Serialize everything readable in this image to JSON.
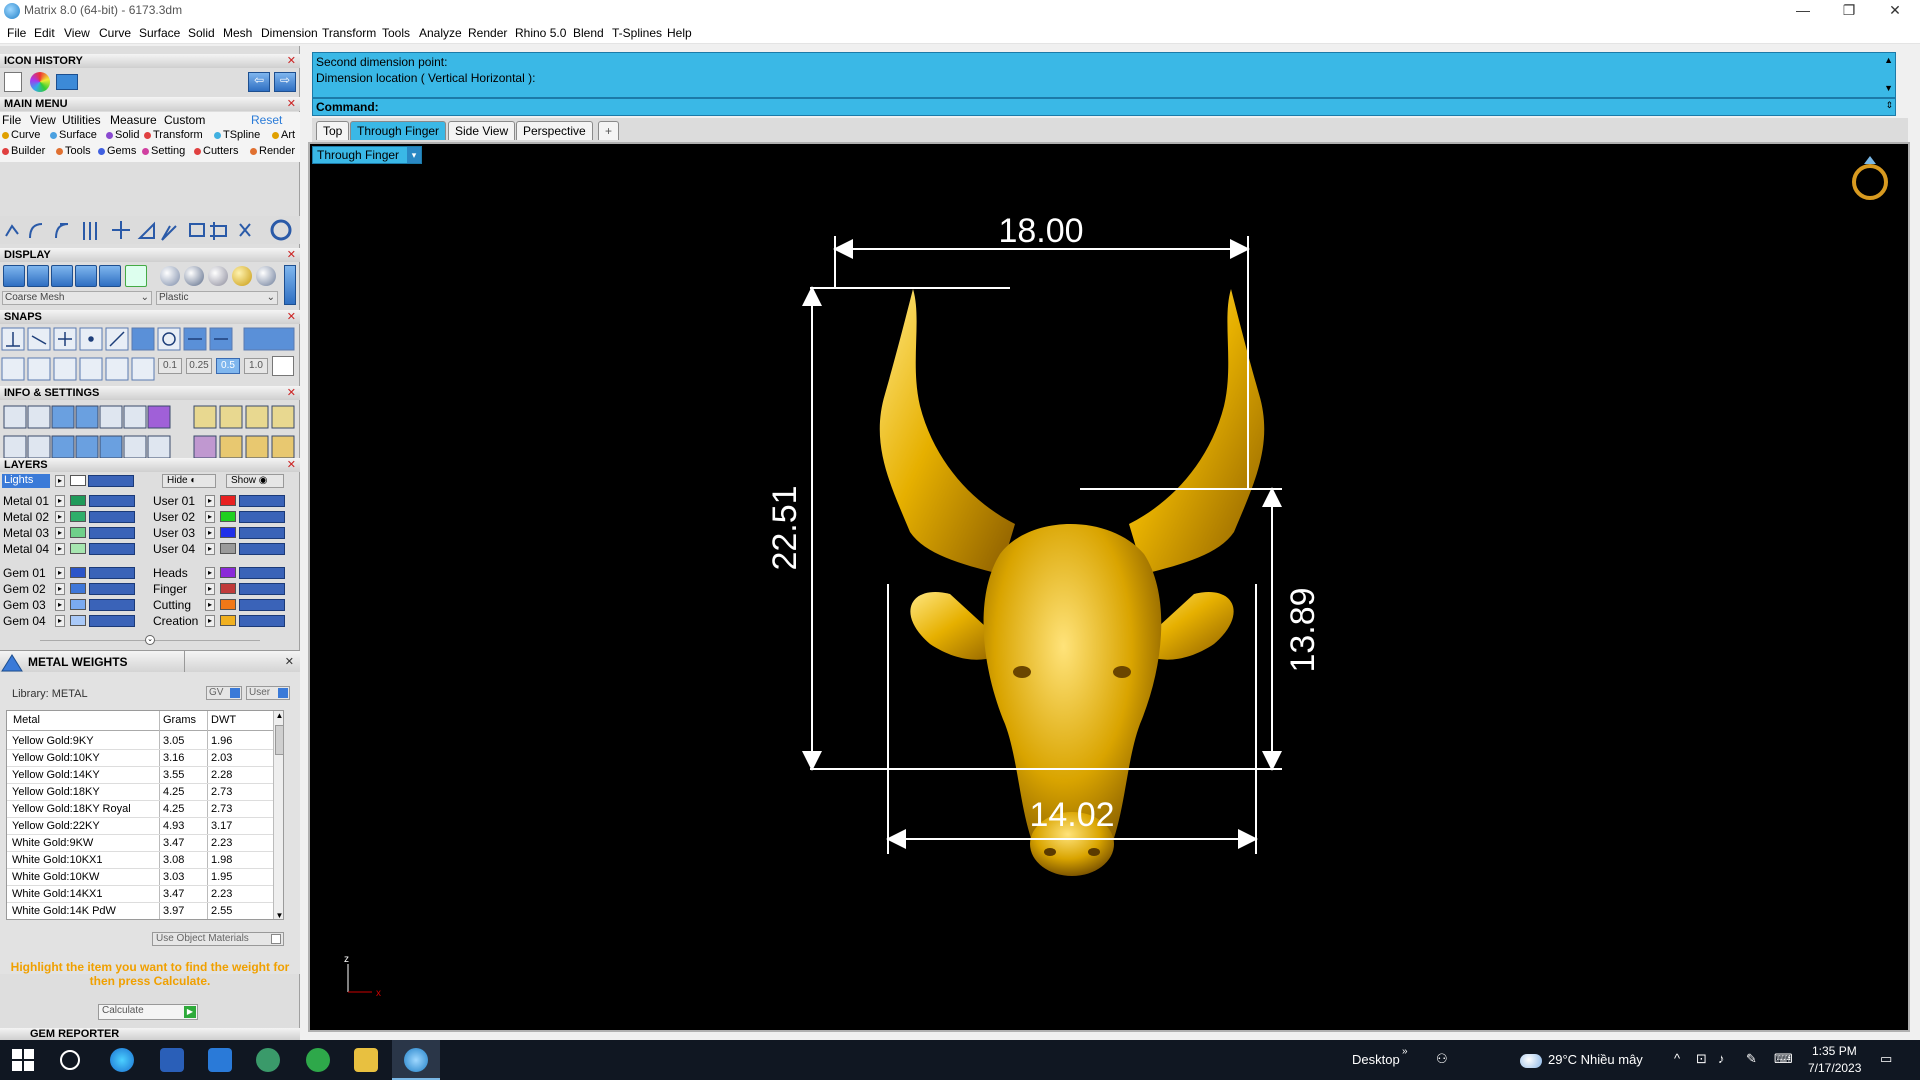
{
  "window": {
    "title": "Matrix 8.0 (64-bit) - 6173.3dm",
    "controls": [
      "—",
      "❐",
      "✕"
    ]
  },
  "menubar": {
    "items": [
      "File",
      "Edit",
      "View",
      "Curve",
      "Surface",
      "Solid",
      "Mesh",
      "Dimension",
      "Transform",
      "Tools",
      "Analyze",
      "Render",
      "Rhino 5.0",
      "Blend",
      "T-Splines",
      "Help"
    ]
  },
  "left_panel": {
    "icon_history": {
      "title": "ICON HISTORY"
    },
    "main_menu": {
      "title": "MAIN MENU",
      "top_items": [
        "File",
        "View",
        "Utilities",
        "Measure",
        "Custom"
      ],
      "reset": "Reset",
      "row1": [
        {
          "label": "Curve",
          "color": "#e0a000"
        },
        {
          "label": "Surface",
          "color": "#4aa0e0"
        },
        {
          "label": "Solid",
          "color": "#8a4ad0"
        },
        {
          "label": "Transform",
          "color": "#e04040"
        },
        {
          "label": "TSpline",
          "color": "#40b0e0"
        },
        {
          "label": "Art",
          "color": "#e0a000"
        }
      ],
      "row2": [
        {
          "label": "Builder",
          "color": "#e04040"
        },
        {
          "label": "Tools",
          "color": "#e07030"
        },
        {
          "label": "Gems",
          "color": "#4060e0"
        },
        {
          "label": "Setting",
          "color": "#d040a0"
        },
        {
          "label": "Cutters",
          "color": "#e04040"
        },
        {
          "label": "Render",
          "color": "#e07030"
        }
      ]
    },
    "display": {
      "title": "DISPLAY",
      "mesh_select": "Coarse Mesh",
      "material_select": "Plastic"
    },
    "snaps": {
      "title": "SNAPS",
      "values": [
        "0.1",
        "0.25",
        "0.5",
        "1.0"
      ]
    },
    "info_settings": {
      "title": "INFO & SETTINGS"
    },
    "layers": {
      "title": "LAYERS",
      "lights": "Lights",
      "hide": "Hide",
      "show": "Show",
      "left": [
        {
          "name": "Metal 01",
          "color": "#1f9a5a"
        },
        {
          "name": "Metal 02",
          "color": "#2fae6a"
        },
        {
          "name": "Metal 03",
          "color": "#6fd08a"
        },
        {
          "name": "Metal 04",
          "color": "#a6e6b0"
        },
        {
          "name": "Gem 01",
          "color": "#2b55c8"
        },
        {
          "name": "Gem 02",
          "color": "#3e77d8"
        },
        {
          "name": "Gem 03",
          "color": "#7aaaf0"
        },
        {
          "name": "Gem 04",
          "color": "#a9c9f8"
        }
      ],
      "right": [
        {
          "name": "User 01",
          "color": "#e82020"
        },
        {
          "name": "User 02",
          "color": "#20d020"
        },
        {
          "name": "User 03",
          "color": "#2030e8"
        },
        {
          "name": "User 04",
          "color": "#9a9a9a"
        },
        {
          "name": "Heads",
          "color": "#8a2ad8"
        },
        {
          "name": "Finger",
          "color": "#c03a3a"
        },
        {
          "name": "Cutting",
          "color": "#f07818"
        },
        {
          "name": "Creation",
          "color": "#f0b020"
        }
      ]
    },
    "metal_weights": {
      "title": "METAL WEIGHTS",
      "library": "Library: METAL",
      "gv": "GV",
      "user": "User",
      "columns": [
        "Metal",
        "Grams",
        "DWT"
      ],
      "rows": [
        [
          "Yellow Gold:9KY",
          "3.05",
          "1.96"
        ],
        [
          "Yellow Gold:10KY",
          "3.16",
          "2.03"
        ],
        [
          "Yellow Gold:14KY",
          "3.55",
          "2.28"
        ],
        [
          "Yellow Gold:18KY",
          "4.25",
          "2.73"
        ],
        [
          "Yellow Gold:18KY Royal",
          "4.25",
          "2.73"
        ],
        [
          "Yellow Gold:22KY",
          "4.93",
          "3.17"
        ],
        [
          "White Gold:9KW",
          "3.47",
          "2.23"
        ],
        [
          "White Gold:10KX1",
          "3.08",
          "1.98"
        ],
        [
          "White Gold:10KW",
          "3.03",
          "1.95"
        ],
        [
          "White Gold:14KX1",
          "3.47",
          "2.23"
        ],
        [
          "White Gold:14K PdW",
          "3.97",
          "2.55"
        ]
      ],
      "use_object_materials": "Use Object Materials",
      "hint": "Highlight the item you want to find the weight for then press Calculate.",
      "calculate": "Calculate"
    },
    "gem_reporter": {
      "title": "GEM REPORTER"
    }
  },
  "command": {
    "lines": [
      "Second dimension point:",
      "Dimension location ( Vertical  Horizontal ):"
    ],
    "label": "Command:",
    "value": ""
  },
  "viewport": {
    "tabs": [
      "Top",
      "Through Finger",
      "Side View",
      "Perspective"
    ],
    "active_tab": "Through Finger",
    "add_tab": "+",
    "view_label": "Through Finger",
    "dimensions": {
      "top_width": "18.00",
      "left_height": "22.51",
      "right_height": "13.89",
      "bottom_width": "14.02"
    },
    "axis_z": "z",
    "axis_x": "x"
  },
  "taskbar": {
    "desktop": "Desktop",
    "weather": "29°C  Nhiều mây",
    "time": "1:35 PM",
    "date": "7/17/2023"
  }
}
